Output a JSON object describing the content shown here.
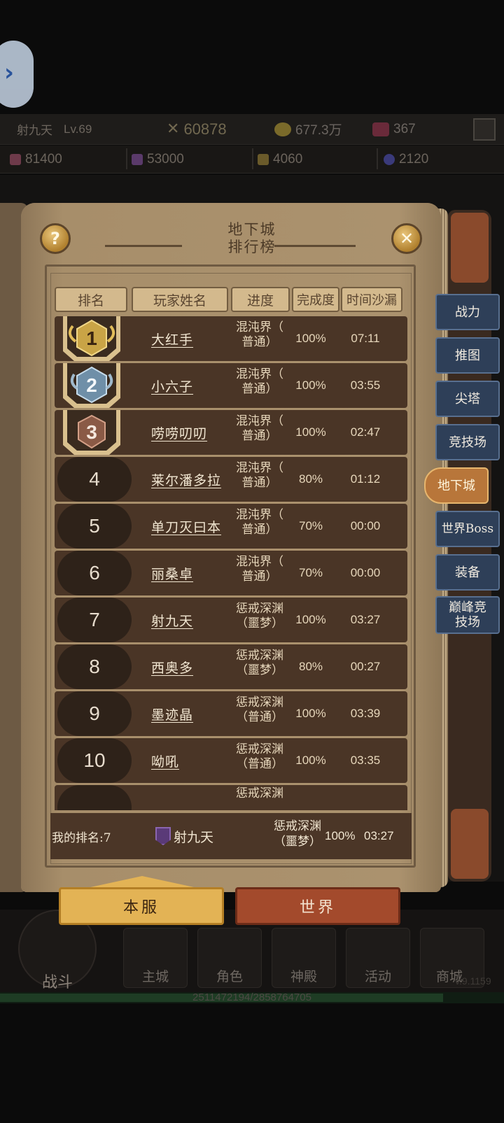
{
  "topbar": {
    "player_name": "射九天",
    "level": "Lv.69",
    "power": "60878",
    "gold": "677.3万",
    "gems": "367"
  },
  "resources": [
    "81400",
    "53000",
    "4060",
    "2120"
  ],
  "panel": {
    "title_line1": "地下城",
    "title_line2": "排行榜",
    "help_label": "?",
    "close_label": "✕"
  },
  "table": {
    "headers": [
      "排名",
      "玩家姓名",
      "进度",
      "完成度",
      "时间沙漏"
    ],
    "rows": [
      {
        "rank": "1",
        "name": "大红手",
        "progress_l1": "混沌界（",
        "progress_l2": "普通）",
        "completion": "100%",
        "time": "07:11"
      },
      {
        "rank": "2",
        "name": "小六子",
        "progress_l1": "混沌界（",
        "progress_l2": "普通）",
        "completion": "100%",
        "time": "03:55"
      },
      {
        "rank": "3",
        "name": "唠唠叨叨",
        "progress_l1": "混沌界（",
        "progress_l2": "普通）",
        "completion": "100%",
        "time": "02:47"
      },
      {
        "rank": "4",
        "name": "莱尔潘多拉",
        "progress_l1": "混沌界（",
        "progress_l2": "普通）",
        "completion": "80%",
        "time": "01:12"
      },
      {
        "rank": "5",
        "name": "单刀灭曰本",
        "progress_l1": "混沌界（",
        "progress_l2": "普通）",
        "completion": "70%",
        "time": "00:00"
      },
      {
        "rank": "6",
        "name": "丽桑卓",
        "progress_l1": "混沌界（",
        "progress_l2": "普通）",
        "completion": "70%",
        "time": "00:00"
      },
      {
        "rank": "7",
        "name": "射九天",
        "progress_l1": "惩戒深渊",
        "progress_l2": "（噩梦）",
        "completion": "100%",
        "time": "03:27"
      },
      {
        "rank": "8",
        "name": "西奥多",
        "progress_l1": "惩戒深渊",
        "progress_l2": "（噩梦）",
        "completion": "80%",
        "time": "00:27"
      },
      {
        "rank": "9",
        "name": "墨迹晶",
        "progress_l1": "惩戒深渊",
        "progress_l2": "（普通）",
        "completion": "100%",
        "time": "03:39"
      },
      {
        "rank": "10",
        "name": "呦吼",
        "progress_l1": "惩戒深渊",
        "progress_l2": "（普通）",
        "completion": "100%",
        "time": "03:35"
      }
    ],
    "partial_row_text": "惩戒深渊"
  },
  "my_rank": {
    "label": "我的排名:7",
    "name": "射九天",
    "progress_l1": "惩戒深渊",
    "progress_l2": "（噩梦）",
    "completion": "100%",
    "time": "03:27"
  },
  "side_tabs": [
    "战力",
    "推图",
    "尖塔",
    "竞技场",
    "地下城",
    "世界Boss",
    "装备",
    "巅峰竞技场"
  ],
  "active_side_tab": "地下城",
  "scope_buttons": {
    "local": "本服",
    "world": "世界"
  },
  "bottom_nav": {
    "battle": "战斗",
    "items": [
      "主城",
      "角色",
      "神殿",
      "活动",
      "商城"
    ]
  },
  "experience": "2511472194/2858764705",
  "version": "v.9.1159",
  "colors": {
    "panel_bg": "#a68d6a",
    "row_bg": "#4a3526",
    "tab_bg": "#2e3f58",
    "tab_active": "#b8763a",
    "gold_button": "#e3b355",
    "red_button": "#a34a2c"
  }
}
